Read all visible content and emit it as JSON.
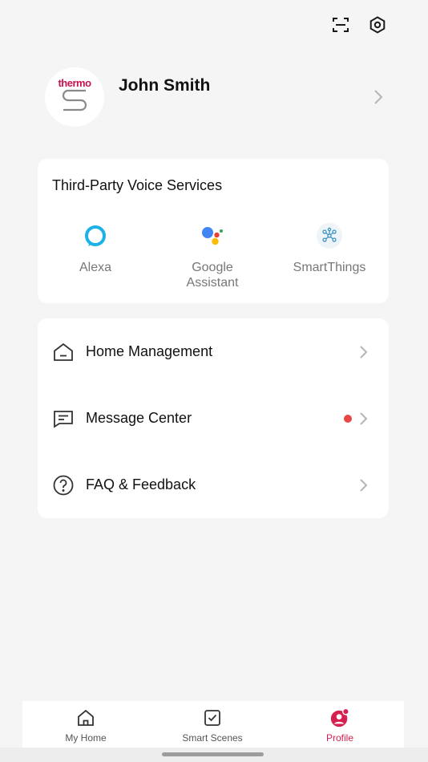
{
  "header": {
    "user_name": "John Smith",
    "avatar_brand_text": "thermo"
  },
  "voice_services": {
    "title": "Third-Party Voice Services",
    "items": [
      {
        "label": "Alexa",
        "icon": "alexa-icon"
      },
      {
        "label": "Google\nAssistant",
        "icon": "google-assistant-icon"
      },
      {
        "label": "SmartThings",
        "icon": "smartthings-icon"
      }
    ]
  },
  "menu": {
    "items": [
      {
        "label": "Home Management",
        "icon": "home-outline-icon"
      },
      {
        "label": "Message Center",
        "icon": "message-icon",
        "unread": true
      },
      {
        "label": "FAQ & Feedback",
        "icon": "question-circle-icon"
      }
    ]
  },
  "tabs": [
    {
      "label": "My Home",
      "icon": "home-icon"
    },
    {
      "label": "Smart Scenes",
      "icon": "checkbox-icon"
    },
    {
      "label": "Profile",
      "icon": "profile-icon",
      "active": true
    }
  ],
  "colors": {
    "accent": "#d6204f",
    "brand": "#c8124f",
    "notification_dot": "#e84545",
    "background": "#f5f5f5",
    "card": "#ffffff"
  }
}
